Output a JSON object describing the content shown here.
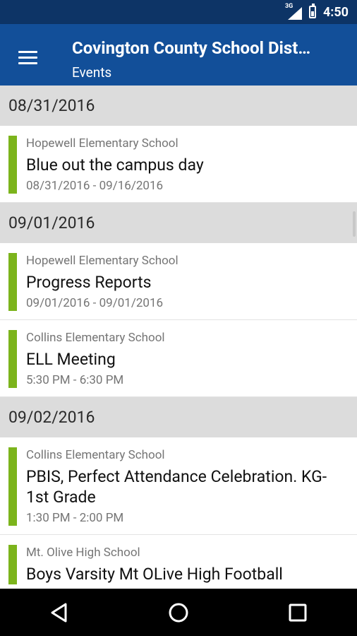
{
  "status_bar": {
    "network": "3G",
    "time": "4:50"
  },
  "app_bar": {
    "title": "Covington County School Dist…",
    "subtitle": "Events"
  },
  "sections": [
    {
      "date": "08/31/2016",
      "events": [
        {
          "school": "Hopewell Elementary School",
          "title": "Blue out the campus day",
          "dates": "08/31/2016 - 09/16/2016"
        }
      ]
    },
    {
      "date": "09/01/2016",
      "events": [
        {
          "school": "Hopewell Elementary School",
          "title": "Progress Reports",
          "dates": "09/01/2016 - 09/01/2016"
        },
        {
          "school": "Collins Elementary School",
          "title": "ELL Meeting",
          "dates": "5:30 PM - 6:30 PM"
        }
      ]
    },
    {
      "date": "09/02/2016",
      "events": [
        {
          "school": "Collins Elementary School",
          "title": "PBIS, Perfect Attendance Celebration. KG-1st Grade",
          "dates": "1:30 PM - 2:00 PM"
        },
        {
          "school": "Mt. Olive High School",
          "title": "Boys Varsity Mt OLive High Football",
          "dates": ""
        }
      ]
    }
  ],
  "colors": {
    "status_bar": "#0d3466",
    "app_bar": "#124f99",
    "event_accent": "#7cb41c",
    "date_header": "#dcdcdc"
  },
  "icons": {
    "menu": "hamburger-menu-icon",
    "back": "back-icon",
    "home": "home-icon",
    "recents": "recents-icon"
  }
}
